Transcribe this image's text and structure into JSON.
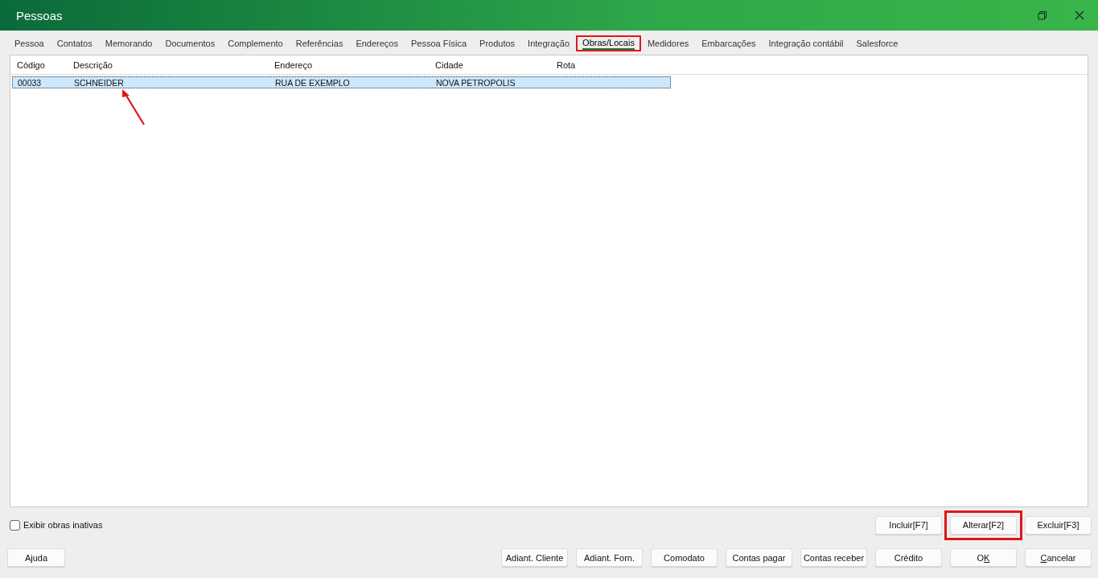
{
  "window": {
    "title": "Pessoas"
  },
  "tabs": [
    {
      "label": "Pessoa",
      "selected": false,
      "highlighted": false
    },
    {
      "label": "Contatos",
      "selected": false,
      "highlighted": false
    },
    {
      "label": "Memorando",
      "selected": false,
      "highlighted": false
    },
    {
      "label": "Documentos",
      "selected": false,
      "highlighted": false
    },
    {
      "label": "Complemento",
      "selected": false,
      "highlighted": false
    },
    {
      "label": "Referências",
      "selected": false,
      "highlighted": false
    },
    {
      "label": "Endereços",
      "selected": false,
      "highlighted": false
    },
    {
      "label": "Pessoa Física",
      "selected": false,
      "highlighted": false
    },
    {
      "label": "Produtos",
      "selected": false,
      "highlighted": false
    },
    {
      "label": "Integração",
      "selected": false,
      "highlighted": false
    },
    {
      "label": "Obras/Locais",
      "selected": true,
      "highlighted": true
    },
    {
      "label": "Medidores",
      "selected": false,
      "highlighted": false
    },
    {
      "label": "Embarcações",
      "selected": false,
      "highlighted": false
    },
    {
      "label": "Integração contábil",
      "selected": false,
      "highlighted": false
    },
    {
      "label": "Salesforce",
      "selected": false,
      "highlighted": false
    }
  ],
  "table": {
    "columns": [
      "Código",
      "Descrição",
      "Endereço",
      "Cidade",
      "Rota"
    ],
    "rows": [
      {
        "cells": [
          "00033",
          "SCHNEIDER",
          "RUA DE EXEMPLO",
          "NOVA PETROPOLIS",
          ""
        ],
        "selected": true
      }
    ]
  },
  "annotation_arrow": {
    "visible": true
  },
  "show_inactive": {
    "label": "Exibir obras inativas",
    "checked": false
  },
  "action_buttons": [
    {
      "label": "Incluir[F7]",
      "highlighted": false
    },
    {
      "label": "Alterar[F2]",
      "highlighted": true
    },
    {
      "label": "Excluir[F3]",
      "highlighted": false
    }
  ],
  "help_button": {
    "label": "Ajuda"
  },
  "footer_buttons": [
    {
      "label": "Adiant. Cliente"
    },
    {
      "label": "Adiant. Forn."
    },
    {
      "label": "Comodato"
    },
    {
      "label": "Contas pagar"
    },
    {
      "label": "Contas receber"
    },
    {
      "label": "Crédito"
    },
    {
      "label_parts": [
        {
          "text": "O",
          "underlined": false
        },
        {
          "text": "K",
          "underlined": true
        }
      ]
    },
    {
      "label_parts": [
        {
          "text": "C",
          "underlined": true
        },
        {
          "text": "ancelar",
          "underlined": false
        }
      ]
    }
  ]
}
